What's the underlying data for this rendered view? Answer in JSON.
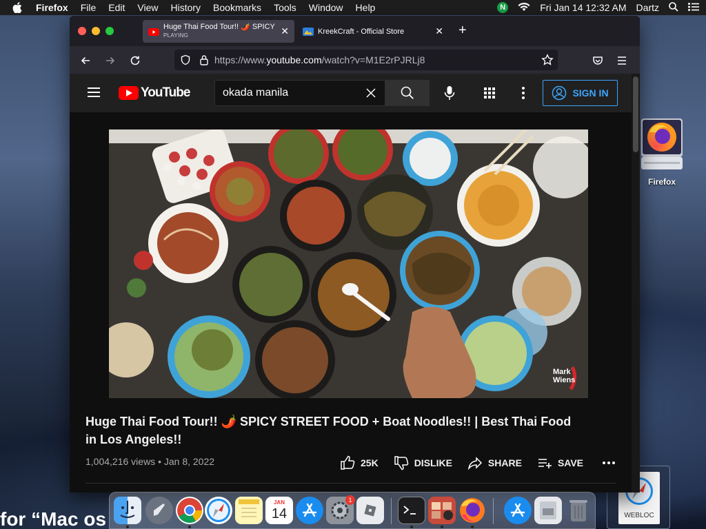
{
  "menubar": {
    "app": "Firefox",
    "items": [
      "File",
      "Edit",
      "View",
      "History",
      "Bookmarks",
      "Tools",
      "Window",
      "Help"
    ],
    "status_badge": "N",
    "datetime": "Fri Jan 14  12:32 AM",
    "user": "Dartz"
  },
  "browser": {
    "tabs": [
      {
        "title": "Huge Thai Food Tour!! 🌶️ SPICY",
        "subtitle": "PLAYING"
      },
      {
        "title": "KreekCraft - Official Store"
      }
    ],
    "url_prefix": "https://www.",
    "url_domain": "youtube.com",
    "url_path": "/watch?v=M1E2rPJRLj8"
  },
  "youtube": {
    "logo_text": "YouTube",
    "search_value": "okada manila",
    "signin_label": "SIGN IN",
    "video_title": "Huge Thai Food Tour!! 🌶️ SPICY STREET FOOD + Boat Noodles!! | Best Thai Food in Los Angeles!!",
    "views_date": "1,004,216 views • Jan 8, 2022",
    "likes": "25K",
    "dislike_label": "DISLIKE",
    "share_label": "SHARE",
    "save_label": "SAVE",
    "watermark_line1": "Mark",
    "watermark_line2": "Wiens"
  },
  "desktop": {
    "firefox_icon_label": "Firefox",
    "webloc_label": "WEBLOC",
    "background_text": "for “Mac os"
  },
  "dock": {
    "calendar_month": "JAN",
    "calendar_day": "14",
    "settings_badge": "1"
  }
}
